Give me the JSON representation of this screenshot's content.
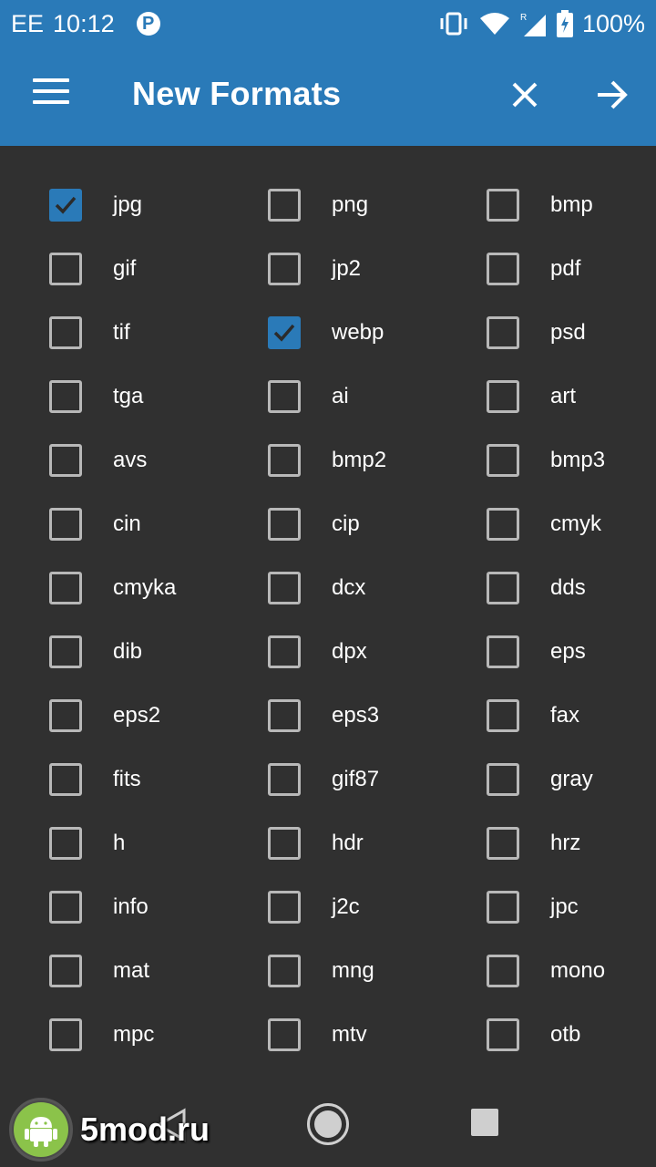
{
  "status_bar": {
    "carrier": "EE",
    "time": "10:12",
    "notification_icon": "P",
    "battery": "100%"
  },
  "app_bar": {
    "title": "New Formats",
    "menu_icon": "hamburger-menu-icon",
    "close_icon": "close-icon",
    "next_icon": "arrow-forward-icon"
  },
  "colors": {
    "primary": "#2a7ab8",
    "background": "#303030",
    "checkbox_border": "#b8b8b8"
  },
  "formats": [
    {
      "label": "jpg",
      "checked": true
    },
    {
      "label": "png",
      "checked": false
    },
    {
      "label": "bmp",
      "checked": false
    },
    {
      "label": "gif",
      "checked": false
    },
    {
      "label": "jp2",
      "checked": false
    },
    {
      "label": "pdf",
      "checked": false
    },
    {
      "label": "tif",
      "checked": false
    },
    {
      "label": "webp",
      "checked": true
    },
    {
      "label": "psd",
      "checked": false
    },
    {
      "label": "tga",
      "checked": false
    },
    {
      "label": "ai",
      "checked": false
    },
    {
      "label": "art",
      "checked": false
    },
    {
      "label": "avs",
      "checked": false
    },
    {
      "label": "bmp2",
      "checked": false
    },
    {
      "label": "bmp3",
      "checked": false
    },
    {
      "label": "cin",
      "checked": false
    },
    {
      "label": "cip",
      "checked": false
    },
    {
      "label": "cmyk",
      "checked": false
    },
    {
      "label": "cmyka",
      "checked": false
    },
    {
      "label": "dcx",
      "checked": false
    },
    {
      "label": "dds",
      "checked": false
    },
    {
      "label": "dib",
      "checked": false
    },
    {
      "label": "dpx",
      "checked": false
    },
    {
      "label": "eps",
      "checked": false
    },
    {
      "label": "eps2",
      "checked": false
    },
    {
      "label": "eps3",
      "checked": false
    },
    {
      "label": "fax",
      "checked": false
    },
    {
      "label": "fits",
      "checked": false
    },
    {
      "label": "gif87",
      "checked": false
    },
    {
      "label": "gray",
      "checked": false
    },
    {
      "label": "h",
      "checked": false
    },
    {
      "label": "hdr",
      "checked": false
    },
    {
      "label": "hrz",
      "checked": false
    },
    {
      "label": "info",
      "checked": false
    },
    {
      "label": "j2c",
      "checked": false
    },
    {
      "label": "jpc",
      "checked": false
    },
    {
      "label": "mat",
      "checked": false
    },
    {
      "label": "mng",
      "checked": false
    },
    {
      "label": "mono",
      "checked": false
    },
    {
      "label": "mpc",
      "checked": false
    },
    {
      "label": "mtv",
      "checked": false
    },
    {
      "label": "otb",
      "checked": false
    }
  ],
  "nav_bar": {
    "back_icon": "back-triangle-icon",
    "home_icon": "home-circle-icon",
    "recents_icon": "recents-square-icon"
  },
  "watermark": {
    "text": "5mod.ru",
    "icon": "android-logo-icon"
  }
}
